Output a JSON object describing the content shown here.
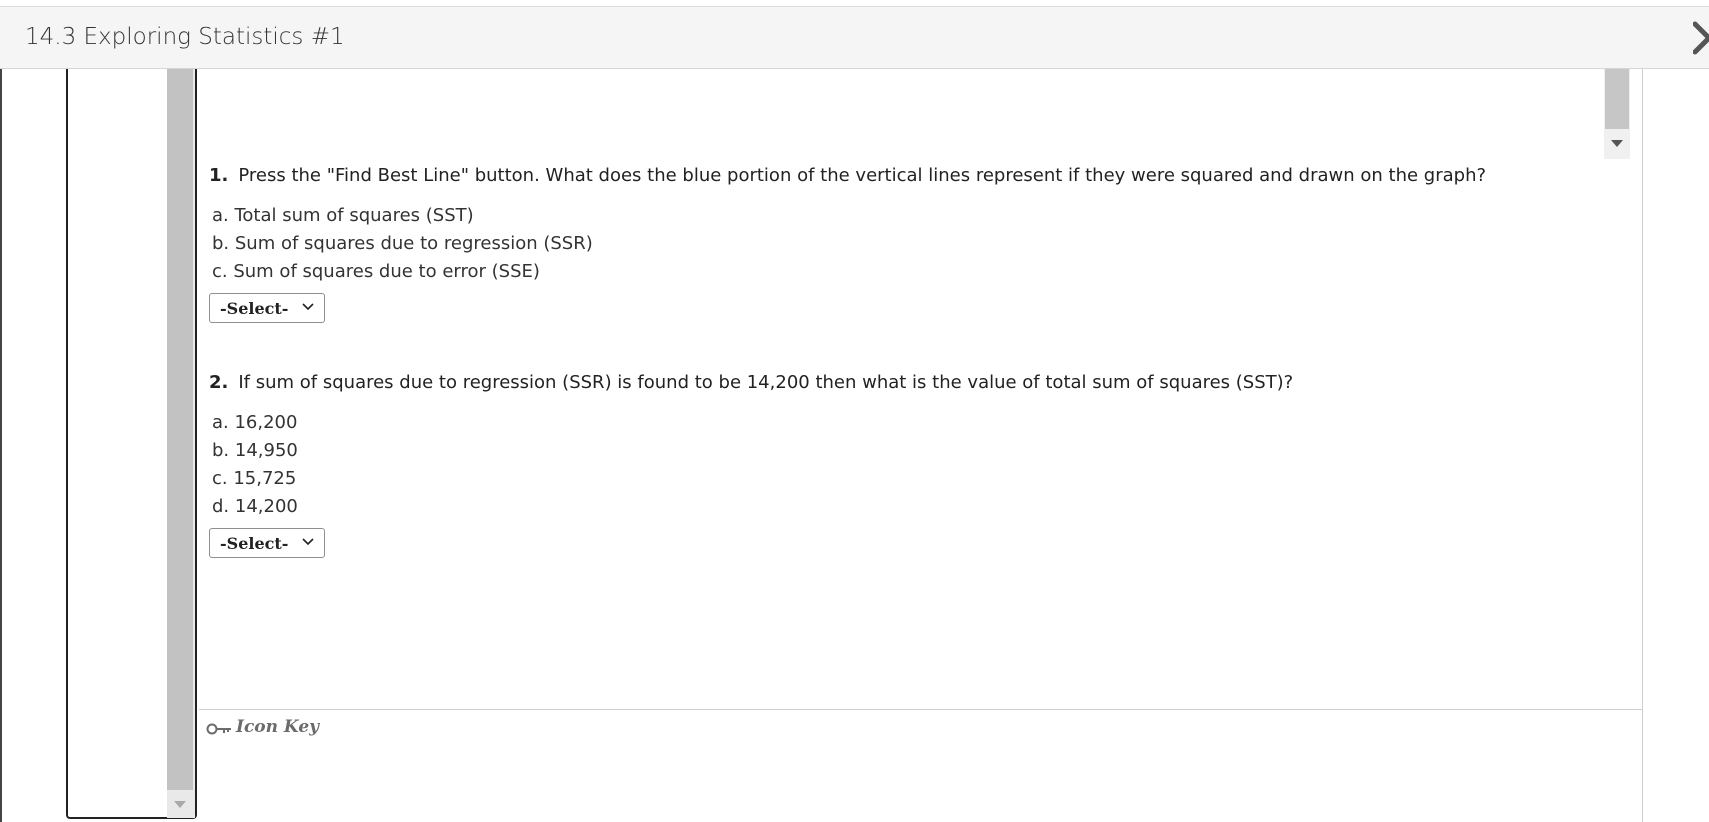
{
  "window": {
    "title": "14.3 Exploring Statistics #1",
    "close_icon": "close-chevron-icon"
  },
  "questions": [
    {
      "number": "1.",
      "text": "Press the \"Find Best Line\" button. What does the blue portion of the vertical lines represent if they were squared and drawn on the graph?",
      "options": [
        "a. Total sum of squares (SST)",
        "b. Sum of squares due to regression (SSR)",
        "c. Sum of squares due to error (SSE)"
      ],
      "select_value": "-Select-"
    },
    {
      "number": "2.",
      "text": "If sum of squares due to regression (SSR) is found to be 14,200 then what is the value of total sum of squares (SST)?",
      "options": [
        "a. 16,200",
        "b. 14,950",
        "c. 15,725",
        "d. 14,200"
      ],
      "select_value": "-Select-"
    }
  ],
  "footer": {
    "icon_key_label": "Icon Key",
    "icon": "key-icon"
  }
}
